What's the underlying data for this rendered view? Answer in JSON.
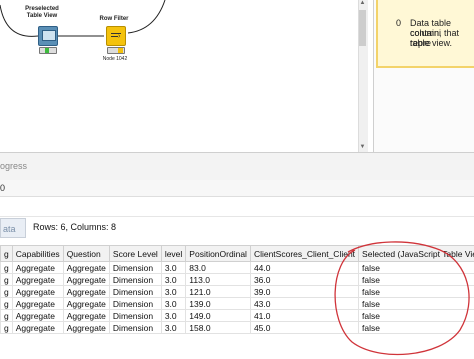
{
  "workflow": {
    "nodes": [
      {
        "label_line1": "Preselected",
        "label_line2": "Table View",
        "sub": ""
      },
      {
        "label_line1": "Row Filter",
        "label_line2": "",
        "sub": "Node 1042"
      }
    ]
  },
  "description": {
    "port_index": "0",
    "text_lines": [
      "Data table containi",
      "column, that repre",
      "table view."
    ]
  },
  "progress": {
    "label": "ogress",
    "value": "0"
  },
  "data_panel": {
    "tab_label": "ata",
    "summary": "Rows: 6, Columns: 8"
  },
  "table": {
    "columns": [
      "g",
      "Capabilities",
      "Question",
      "Score Level",
      "level",
      "PositionOrdinal",
      "ClientScores_Client_Client",
      "Selected (JavaScript Table View)"
    ],
    "rows": [
      [
        "g",
        "Aggregate",
        "Aggregate",
        "Dimension",
        "3.0",
        "83.0",
        "44.0",
        "false"
      ],
      [
        "g",
        "Aggregate",
        "Aggregate",
        "Dimension",
        "3.0",
        "113.0",
        "36.0",
        "false"
      ],
      [
        "g",
        "Aggregate",
        "Aggregate",
        "Dimension",
        "3.0",
        "121.0",
        "39.0",
        "false"
      ],
      [
        "g",
        "Aggregate",
        "Aggregate",
        "Dimension",
        "3.0",
        "139.0",
        "43.0",
        "false"
      ],
      [
        "g",
        "Aggregate",
        "Aggregate",
        "Dimension",
        "3.0",
        "149.0",
        "41.0",
        "false"
      ],
      [
        "g",
        "Aggregate",
        "Aggregate",
        "Dimension",
        "3.0",
        "158.0",
        "45.0",
        "false"
      ]
    ]
  },
  "colors": {
    "annotation": "#d0343a",
    "row_filter_node": "#f4c20d",
    "view_node": "#5a8fb6"
  }
}
